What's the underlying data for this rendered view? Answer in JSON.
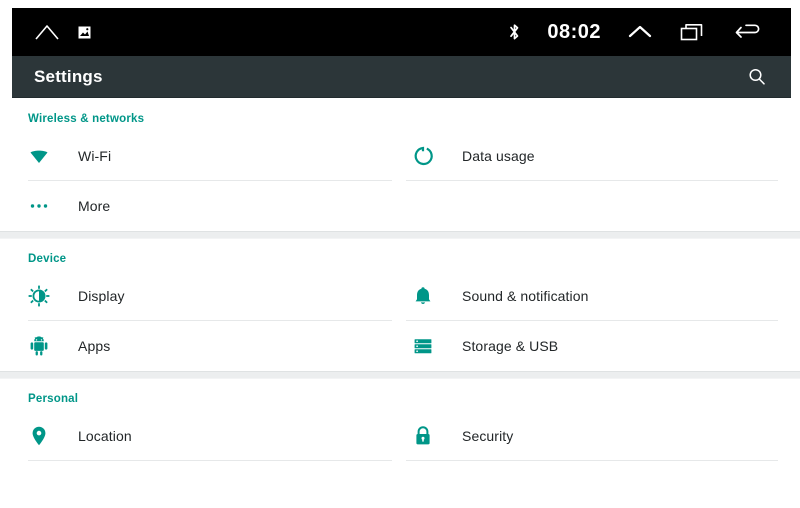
{
  "statusbar": {
    "home_icon": "home-icon",
    "screenshot_icon": "screenshot-icon",
    "bluetooth_icon": "bluetooth-icon",
    "clock": "08:02",
    "expand_icon": "chevron-up-icon",
    "recents_icon": "recents-icon",
    "back_icon": "back-arrow-icon"
  },
  "actionbar": {
    "title": "Settings",
    "search_icon": "search-icon"
  },
  "colors": {
    "accent": "#009688",
    "actionbar_bg": "#2c3639",
    "statusbar_bg": "#000000",
    "text": "#222628",
    "divider": "#e6e8e9",
    "band": "#eceeef"
  },
  "sections": [
    {
      "header": "Wireless & networks",
      "rows": [
        {
          "left": {
            "label": "Wi-Fi",
            "icon": "wifi-icon"
          },
          "right": {
            "label": "Data usage",
            "icon": "data-usage-icon"
          }
        },
        {
          "left": {
            "label": "More",
            "icon": "more-icon"
          },
          "right": {
            "label": "",
            "icon": ""
          }
        }
      ]
    },
    {
      "header": "Device",
      "rows": [
        {
          "left": {
            "label": "Display",
            "icon": "brightness-icon"
          },
          "right": {
            "label": "Sound & notification",
            "icon": "bell-icon"
          }
        },
        {
          "left": {
            "label": "Apps",
            "icon": "android-icon"
          },
          "right": {
            "label": "Storage & USB",
            "icon": "storage-icon"
          }
        }
      ]
    },
    {
      "header": "Personal",
      "rows": [
        {
          "left": {
            "label": "Location",
            "icon": "location-pin-icon"
          },
          "right": {
            "label": "Security",
            "icon": "lock-icon"
          }
        }
      ]
    }
  ]
}
